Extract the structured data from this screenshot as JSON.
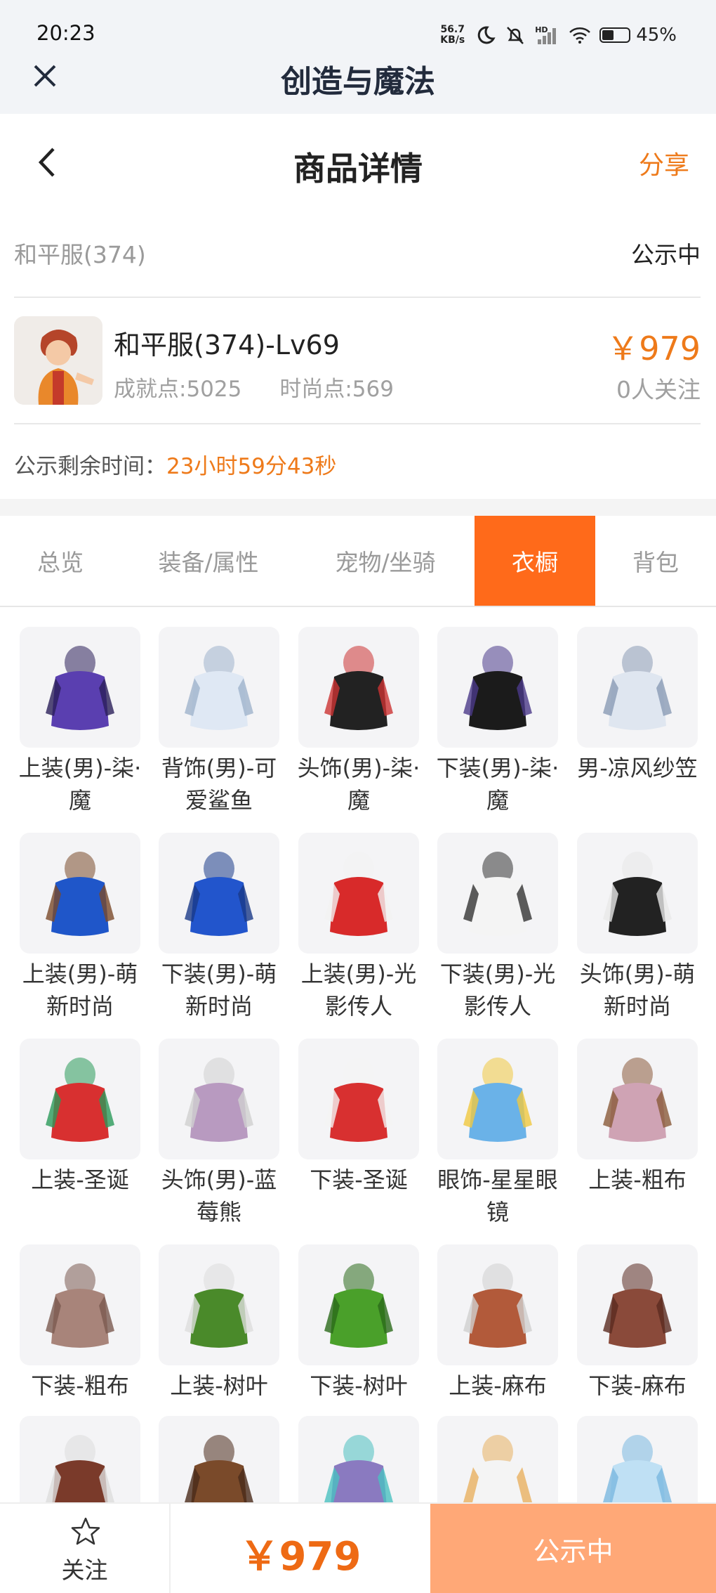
{
  "status_bar": {
    "time": "20:23",
    "net_speed_top": "56.7",
    "net_speed_bottom": "KB/s",
    "hd": "HD",
    "battery": "45%",
    "battery_level": 0.45
  },
  "app": {
    "title": "创造与魔法"
  },
  "nav": {
    "title": "商品详情",
    "share_label": "分享"
  },
  "listing": {
    "name": "和平服(374)",
    "status": "公示中",
    "title": "和平服(374)-Lv69",
    "achievement": "成就点:5025",
    "fashion": "时尚点:569",
    "price": "￥979",
    "followers": "0人关注",
    "countdown_label": "公示剩余时间：",
    "countdown_value": "23小时59分43秒"
  },
  "tabs": [
    {
      "label": "总览",
      "active": false
    },
    {
      "label": "装备/属性",
      "active": false
    },
    {
      "label": "宠物/坐骑",
      "active": false
    },
    {
      "label": "衣橱",
      "active": true
    },
    {
      "label": "背包",
      "active": false
    }
  ],
  "wardrobe": [
    {
      "label": "上装(男)-柒·魔"
    },
    {
      "label": "背饰(男)-可爱鲨鱼"
    },
    {
      "label": "头饰(男)-柒·魔"
    },
    {
      "label": "下装(男)-柒·魔"
    },
    {
      "label": "男-凉风纱笠"
    },
    {
      "label": "上装(男)-萌新时尚"
    },
    {
      "label": "下装(男)-萌新时尚"
    },
    {
      "label": "上装(男)-光影传人"
    },
    {
      "label": "下装(男)-光影传人"
    },
    {
      "label": "头饰(男)-萌新时尚"
    },
    {
      "label": "上装-圣诞"
    },
    {
      "label": "头饰(男)-蓝莓熊"
    },
    {
      "label": "下装-圣诞"
    },
    {
      "label": "眼饰-星星眼镜"
    },
    {
      "label": "上装-粗布"
    },
    {
      "label": "下装-粗布"
    },
    {
      "label": "上装-树叶"
    },
    {
      "label": "下装-树叶"
    },
    {
      "label": "上装-麻布"
    },
    {
      "label": "下装-麻布"
    },
    {
      "label": ""
    },
    {
      "label": ""
    },
    {
      "label": ""
    },
    {
      "label": ""
    },
    {
      "label": ""
    }
  ],
  "bottom_bar": {
    "follow_label": "关注",
    "price": "￥979",
    "action_label": "公示中"
  }
}
